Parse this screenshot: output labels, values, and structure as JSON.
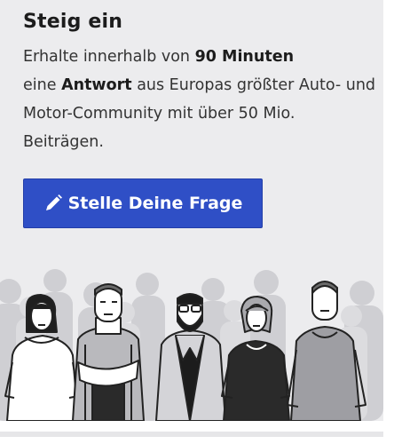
{
  "card": {
    "title": "Steig ein",
    "intro_part1": "Erhalte innerhalb von ",
    "intro_bold1": "90 Minuten",
    "intro_part2": " eine ",
    "intro_bold2": "Antwort",
    "intro_part3": " aus Europas größter Auto- und Motor-Community mit über 50 Mio. Beiträgen.",
    "cta_label": "Stelle Deine Frage",
    "cta_icon": "pencil-icon",
    "illustration": "community-people-illustration"
  },
  "colors": {
    "card_background": "#ececee",
    "button_background": "#2f4fc6",
    "button_text": "#ffffff",
    "heading_text": "#1c1c1c"
  }
}
